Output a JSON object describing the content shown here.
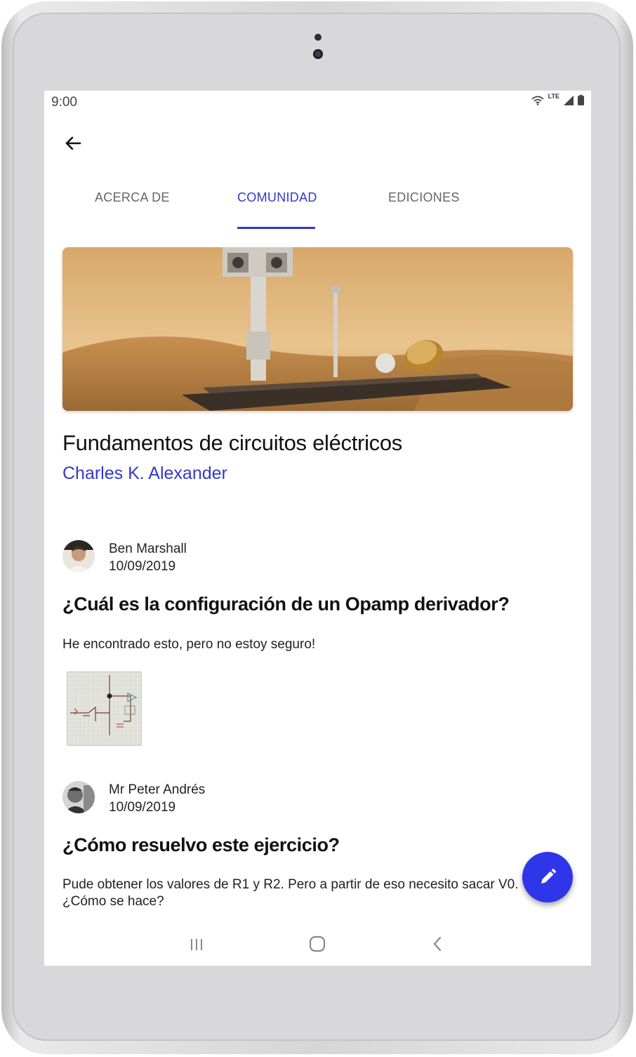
{
  "status_bar": {
    "time": "9:00",
    "network": "LTE"
  },
  "tabs": [
    {
      "label": "ACERCA DE",
      "active": false
    },
    {
      "label": "COMUNIDAD",
      "active": true
    },
    {
      "label": "EDICIONES",
      "active": false
    }
  ],
  "book": {
    "title": "Fundamentos de circuitos eléctricos",
    "author": "Charles K. Alexander"
  },
  "posts": [
    {
      "user": "Ben Marshall",
      "date": "10/09/2019",
      "title": "¿Cuál es la configuración de un Opamp derivador?",
      "body": "He encontrado esto, pero no estoy seguro!"
    },
    {
      "user": "Mr Peter Andrés",
      "date": "10/09/2019",
      "title": "¿Cómo resuelvo este ejercicio?",
      "body": "Pude obtener los valores de R1 y R2. Pero a partir de eso necesito sacar V0. ¿Cómo se hace?"
    }
  ],
  "colors": {
    "accent": "#3239c9",
    "fab": "#2f35e8"
  },
  "icons": {
    "back": "arrow-left-icon",
    "fab": "pencil-icon"
  }
}
